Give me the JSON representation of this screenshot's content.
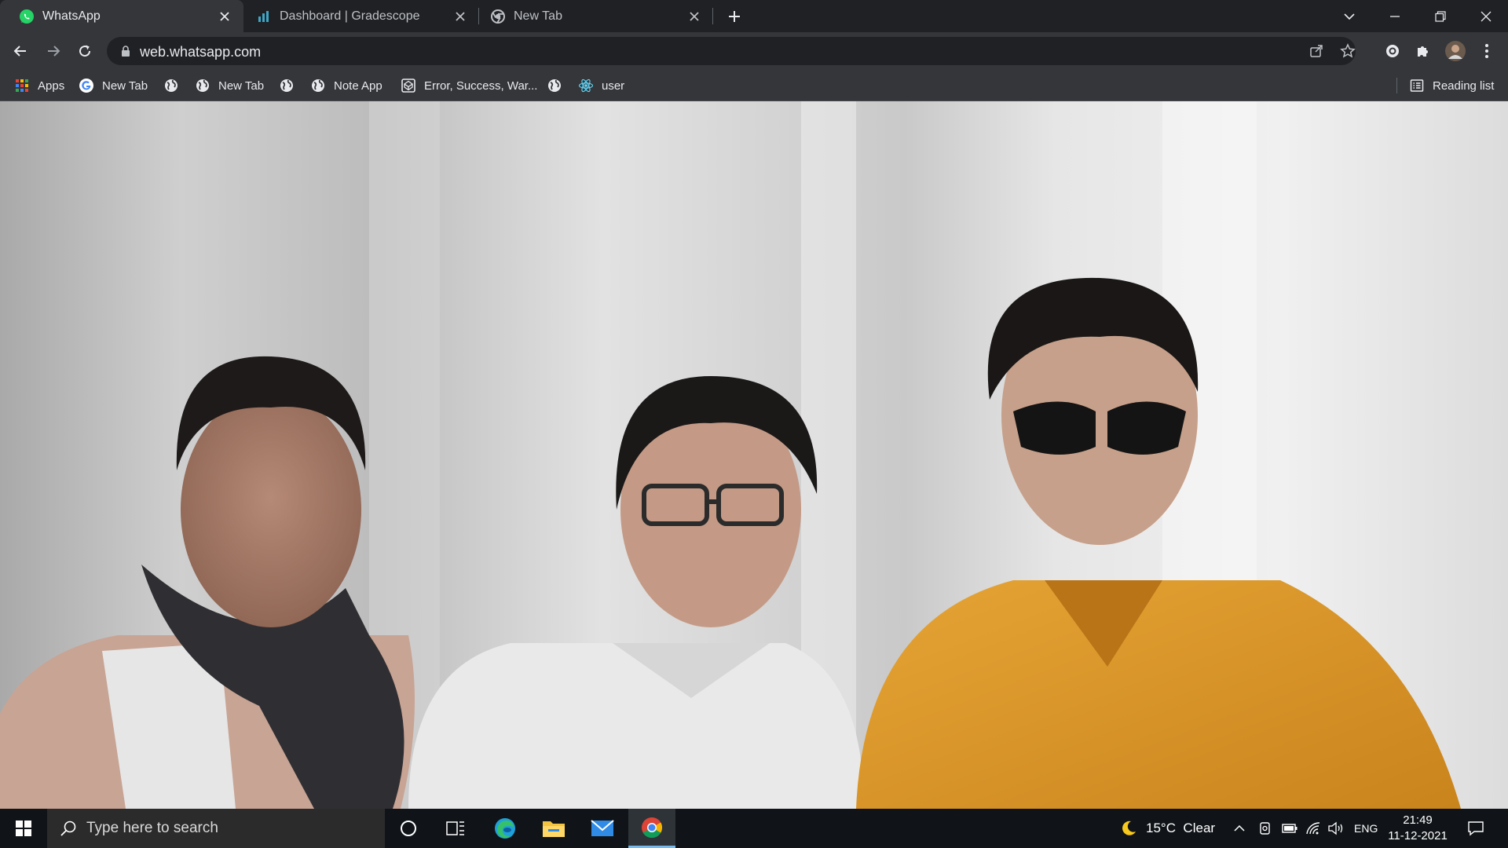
{
  "browser": {
    "tabs": [
      {
        "title": "WhatsApp",
        "icon": "whatsapp-icon",
        "active": true
      },
      {
        "title": "Dashboard | Gradescope",
        "icon": "gradescope-icon",
        "active": false
      },
      {
        "title": "New Tab",
        "icon": "chrome-icon",
        "active": false
      }
    ],
    "url": "web.whatsapp.com",
    "bookmarks": [
      {
        "label": "Apps",
        "icon": "apps-grid-icon"
      },
      {
        "label": "New Tab",
        "icon": "google-icon"
      },
      {
        "label": "",
        "icon": "globe-icon"
      },
      {
        "label": "New Tab",
        "icon": "globe-icon"
      },
      {
        "label": "",
        "icon": "globe-icon"
      },
      {
        "label": "Note App",
        "icon": "globe-icon"
      },
      {
        "label": "Error, Success, War...",
        "icon": "codepen-icon"
      },
      {
        "label": "",
        "icon": "globe-icon"
      },
      {
        "label": "user",
        "icon": "react-icon"
      }
    ],
    "reading_list": "Reading list"
  },
  "taskbar": {
    "search_placeholder": "Type here to search",
    "weather": "15°C  Clear",
    "language": "ENG",
    "time": "21:49",
    "date": "11-12-2021"
  },
  "colors": {
    "tabstrip": "#202124",
    "toolbar": "#35363a",
    "taskbar": "#101418",
    "whatsapp_green": "#25d366",
    "accent_blue": "#8ab4f8"
  }
}
